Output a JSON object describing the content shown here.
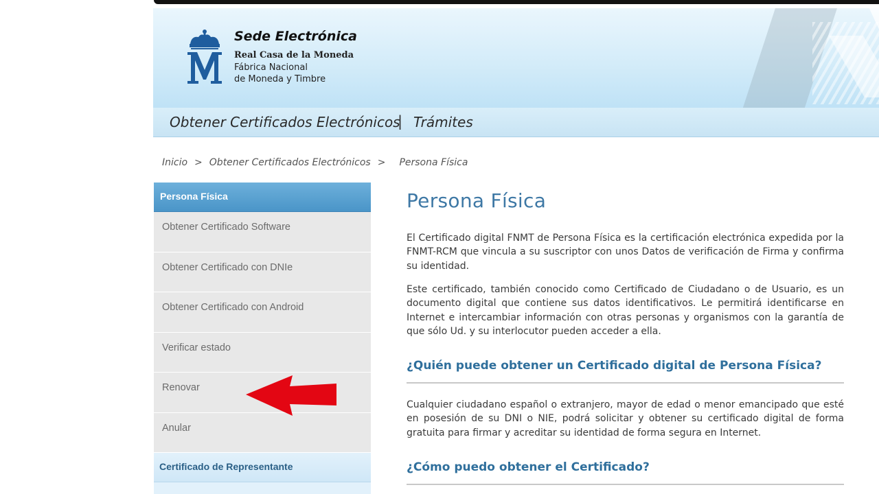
{
  "brand": {
    "title": "Sede Electrónica",
    "line1": "Real Casa de la Moneda",
    "line2": "Fábrica Nacional",
    "line3": "de Moneda y Timbre",
    "logo_icon": "crowned-m-emblem-icon",
    "logo_color": "#1f5d9e"
  },
  "nav": {
    "items": [
      {
        "label": "Obtener Certificados Electrónicos"
      },
      {
        "label": "Trámites"
      }
    ],
    "separator": "|"
  },
  "breadcrumb": {
    "items": [
      "Inicio",
      "Obtener Certificados Electrónicos",
      "Persona Física"
    ],
    "separator": ">"
  },
  "sidebar": {
    "header": "Persona Física",
    "items": [
      {
        "label": "Obtener Certificado Software"
      },
      {
        "label": "Obtener Certificado con DNIe"
      },
      {
        "label": "Obtener Certificado con Android"
      },
      {
        "label": "Verificar estado"
      },
      {
        "label": "Renovar"
      },
      {
        "label": "Anular"
      }
    ],
    "section": "Certificado de Representante"
  },
  "annotation": {
    "icon": "red-arrow-left-icon",
    "color": "#e30613"
  },
  "main": {
    "title": "Persona Física",
    "p1": "El Certificado digital FNMT de Persona Física es la certificación electrónica expedida por la FNMT-RCM que vincula a su suscriptor con unos Datos de verificación de Firma y confirma su identidad.",
    "p2": "Este certificado, también conocido como Certificado de Ciudadano o de Usuario, es un documento digital que contiene sus datos identificativos. Le permitirá identificarse en Internet e intercambiar información con otras personas y organismos con la garantía de que sólo Ud. y su interlocutor pueden acceder a ella.",
    "h1": "¿Quién puede obtener un Certificado digital de Persona Física?",
    "p3": "Cualquier ciudadano español o extranjero, mayor de edad o menor emancipado que esté en posesión de su DNI o NIE, podrá solicitar y obtener su certificado digital de forma gratuita para firmar y acreditar su identidad de forma segura en Internet.",
    "h2": "¿Cómo puedo obtener el Certificado?"
  },
  "colors": {
    "accent_blue": "#3e78a5",
    "sidebar_header": "#4a95c8",
    "nav_bg": "#c8e4f4"
  }
}
